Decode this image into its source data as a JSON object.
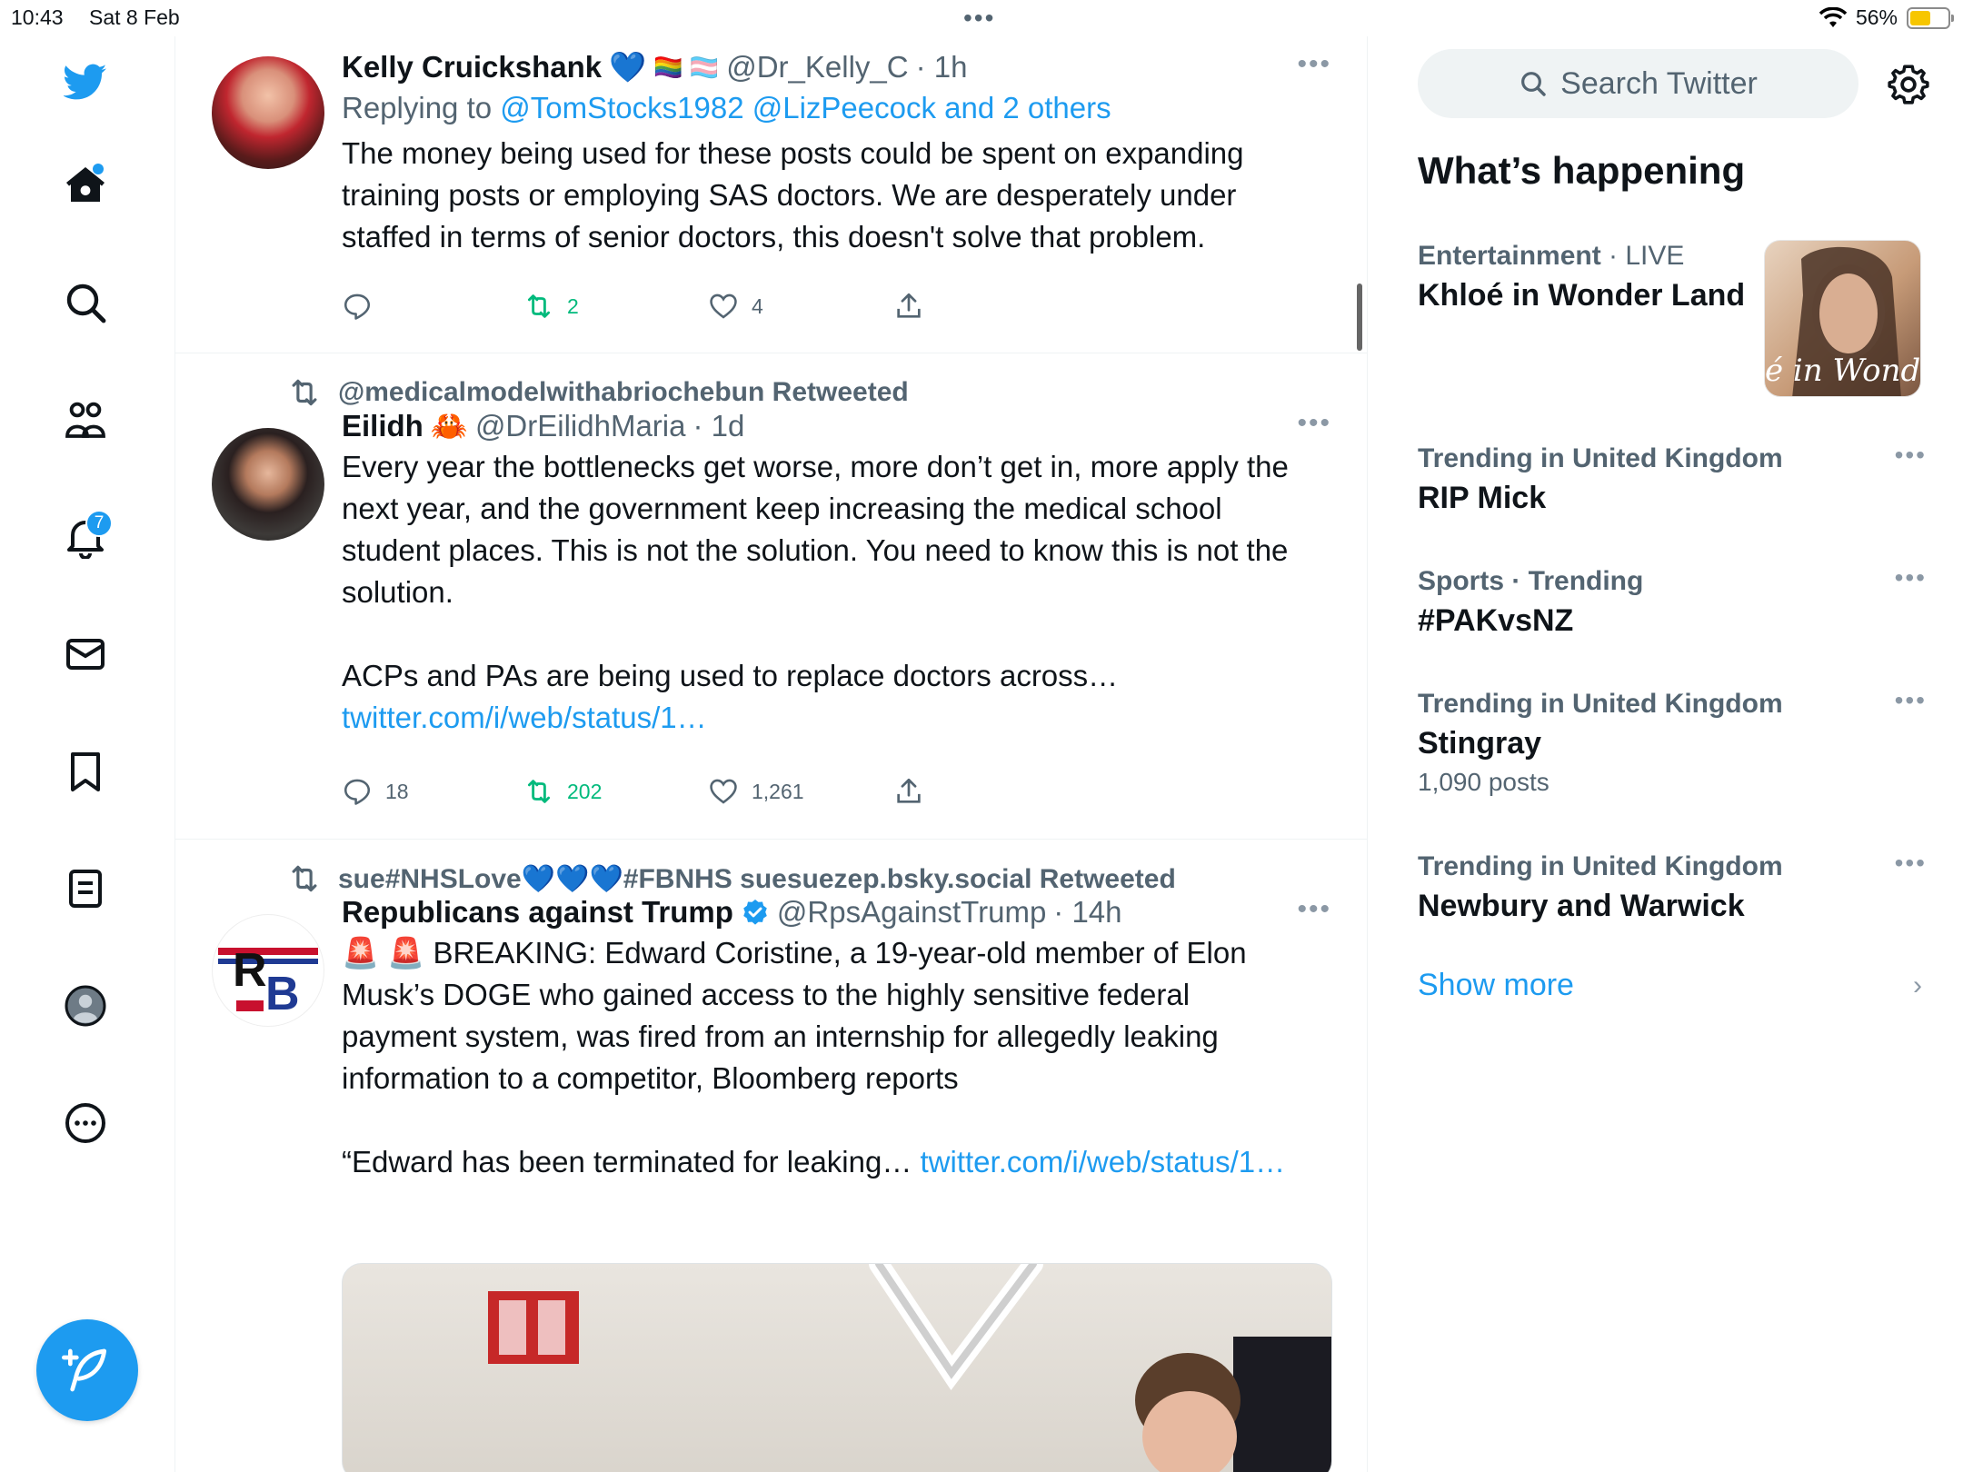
{
  "status_bar": {
    "time": "10:43",
    "date": "Sat 8 Feb",
    "battery_percent": "56%",
    "battery_level": 0.56
  },
  "nav": {
    "items": [
      {
        "name": "twitter-logo",
        "icon": "bird-icon"
      },
      {
        "name": "home",
        "icon": "home-icon",
        "has_dot": true
      },
      {
        "name": "explore",
        "icon": "search-icon"
      },
      {
        "name": "communities",
        "icon": "people-icon"
      },
      {
        "name": "notifications",
        "icon": "bell-icon",
        "badge": "7"
      },
      {
        "name": "messages",
        "icon": "mail-icon"
      },
      {
        "name": "bookmarks",
        "icon": "bookmark-icon"
      },
      {
        "name": "lists",
        "icon": "list-icon"
      },
      {
        "name": "profile",
        "icon": "avatar-icon"
      },
      {
        "name": "more",
        "icon": "more-circle-icon"
      }
    ],
    "compose_icon": "compose-feather-icon"
  },
  "tweets": [
    {
      "name": "Kelly Cruickshank",
      "emoji_after_name": "💙",
      "flags": "🏳️‍🌈 🏳️‍⚧️",
      "handle": "@Dr_Kelly_C",
      "time": "· 1h",
      "replying_prefix": "Replying to ",
      "replying_to": "@TomStocks1982 @LizPeecock and 2 others",
      "text": "The money being used for these posts could be spent on expanding training posts or employing SAS doctors. We are desperately under staffed in terms of senior doctors, this doesn't solve that problem.",
      "replies": "",
      "retweets": "2",
      "likes": "4"
    },
    {
      "retweeted_by": "@medicalmodelwithabriochebun Retweeted",
      "name": "Eilidh",
      "emoji_after_name": "🦀",
      "handle": "@DrEilidhMaria",
      "time": "· 1d",
      "text": "Every year the bottlenecks get worse, more don’t get in, more apply the next year, and the government keep increasing the medical school student places. This is not the solution. You need to know this is not the solution.\n\nACPs and PAs are being used to replace doctors across… ",
      "link": "twitter.com/i/web/status/1…",
      "replies": "18",
      "retweets": "202",
      "likes": "1,261"
    },
    {
      "retweeted_by": "sue#NHSLove💙💙💙#FBNHS suesuezep.bsky.social Retweeted",
      "name": "Republicans against Trump",
      "verified": true,
      "handle": "@RpsAgainstTrump",
      "time": "· 14h",
      "text": "🚨 🚨 BREAKING: Edward Coristine, a 19-year-old member of Elon Musk’s DOGE who gained access to the highly sensitive federal payment system, was fired from an internship for allegedly leaking information to a competitor, Bloomberg reports\n\n“Edward has been terminated for leaking… ",
      "link": "twitter.com/i/web/status/1…"
    }
  ],
  "sidebar": {
    "search_placeholder": "Search Twitter",
    "section_title": "What’s happening",
    "trends": [
      {
        "category": "Entertainment",
        "live": " · LIVE",
        "title": "Khloé in Wonder Land",
        "thumb_text": "é in Wonder L"
      },
      {
        "category": "Trending in United Kingdom",
        "title": "RIP Mick"
      },
      {
        "category": "Sports · Trending",
        "title": "#PAKvsNZ"
      },
      {
        "category": "Trending in United Kingdom",
        "title": "Stingray",
        "count": "1,090 posts"
      },
      {
        "category": "Trending in United Kingdom",
        "title": "Newbury and Warwick"
      }
    ],
    "show_more": "Show more"
  },
  "colors": {
    "accent": "#1d9bf0",
    "retweet_green": "#00ba7c",
    "secondary_text": "#536471"
  }
}
